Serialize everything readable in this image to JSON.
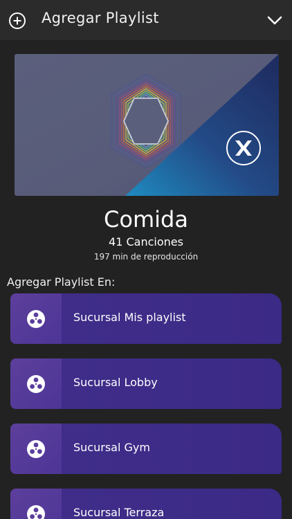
{
  "header": {
    "title": "Agregar Playlist",
    "add_icon": "plus-circle-icon",
    "collapse_icon": "chevron-down-icon"
  },
  "cover": {
    "brand_icon": "x-logo-icon"
  },
  "playlist": {
    "name": "Comida",
    "song_count": "41 Canciones",
    "duration": "197 min de reproducción"
  },
  "section_label": "Agregar Playlist En:",
  "branches": [
    {
      "label": "Sucursal Mis playlist",
      "icon": "reel-icon"
    },
    {
      "label": "Sucursal Lobby",
      "icon": "reel-icon"
    },
    {
      "label": "Sucursal Gym",
      "icon": "reel-icon"
    },
    {
      "label": "Sucursal Terraza",
      "icon": "reel-icon"
    }
  ],
  "colors": {
    "background": "#222222",
    "header": "#2b2b2b",
    "branch_bg": "#3e2c88",
    "branch_icon_bg": "#5a3e9c",
    "accent_blue": "#1f6fa8"
  }
}
